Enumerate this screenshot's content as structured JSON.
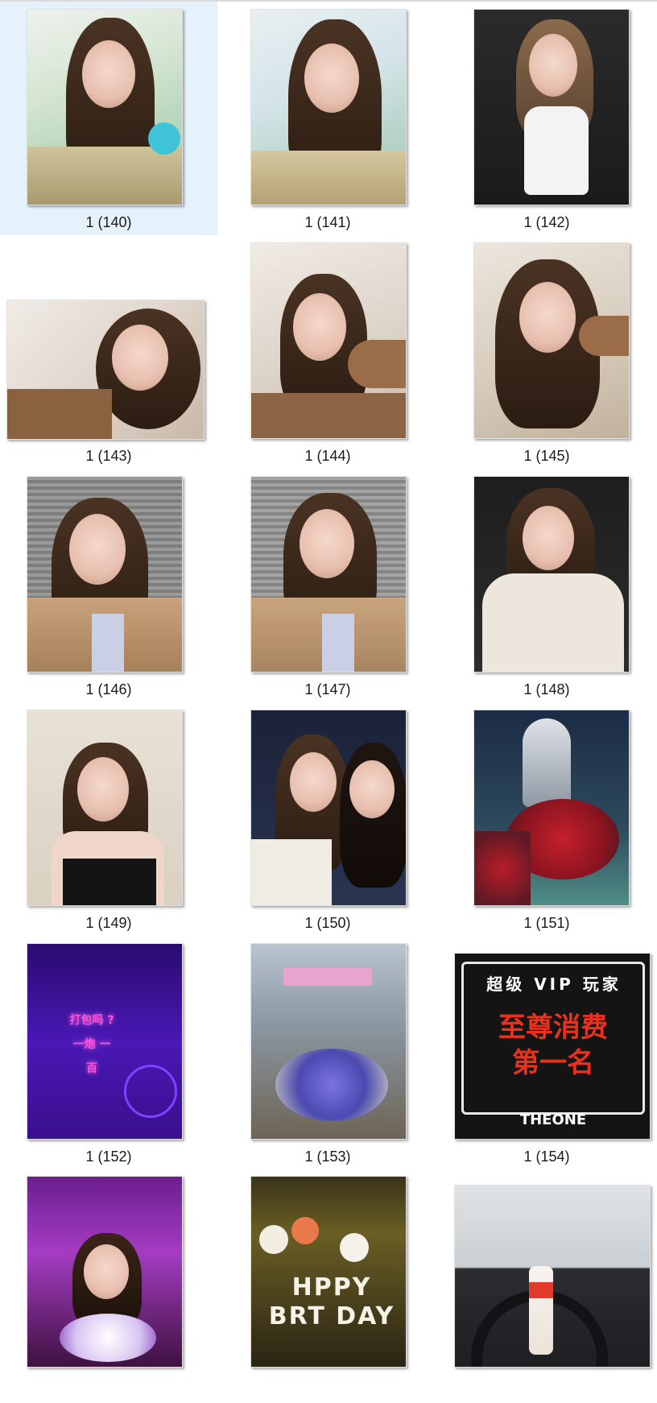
{
  "files": [
    {
      "name": "1 (140)",
      "selected": true
    },
    {
      "name": "1 (141)"
    },
    {
      "name": "1 (142)"
    },
    {
      "name": "1 (143)"
    },
    {
      "name": "1 (144)"
    },
    {
      "name": "1 (145)"
    },
    {
      "name": "1 (146)"
    },
    {
      "name": "1 (147)"
    },
    {
      "name": "1 (148)"
    },
    {
      "name": "1 (149)"
    },
    {
      "name": "1 (150)"
    },
    {
      "name": "1 (151)"
    },
    {
      "name": "1 (152)"
    },
    {
      "name": "1 (153)"
    },
    {
      "name": "1 (154)"
    },
    {
      "name": ""
    },
    {
      "name": ""
    },
    {
      "name": ""
    }
  ],
  "photo_text": {
    "vip_line": "超级 VIP 玩家",
    "rank_line1": "至尊消费",
    "rank_line2": "第一名",
    "brand": "THEONE",
    "neon_text": "打包吗 ? 一炮 一百",
    "birthday_letters": "HPPY BRT DAY"
  },
  "colors": {
    "selection_bg": "#e5f1fb",
    "caption_text": "#1a1a1a",
    "neon_purple": "#5b1fd6",
    "sign_red": "#e8321e"
  }
}
